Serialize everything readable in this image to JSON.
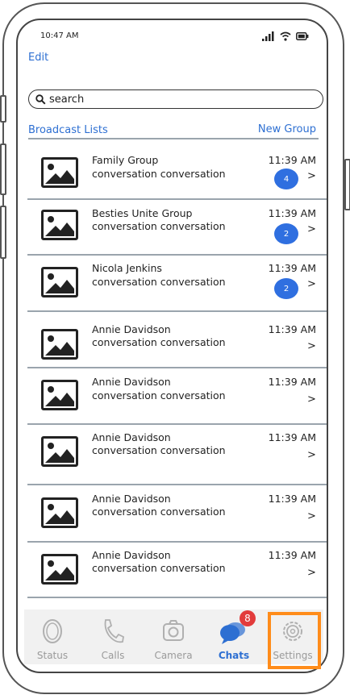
{
  "status_bar": {
    "time": "10:47 AM",
    "icons": [
      "signal-icon",
      "wifi-icon",
      "battery-icon"
    ]
  },
  "header": {
    "edit_label": "Edit"
  },
  "search": {
    "value": "search"
  },
  "lists": {
    "broadcast_label": "Broadcast Lists",
    "new_group_label": "New Group"
  },
  "chats": [
    {
      "name": "Family Group",
      "preview": "conversation conversation",
      "time": "11:39 AM",
      "badge": "4"
    },
    {
      "name": "Besties Unite Group",
      "preview": "conversation conversation",
      "time": "11:39 AM",
      "badge": "2"
    },
    {
      "name": "Nicola Jenkins",
      "preview": "conversation conversation",
      "time": "11:39 AM",
      "badge": "2"
    },
    {
      "name": "Annie Davidson",
      "preview": "conversation conversation",
      "time": "11:39 AM",
      "badge": ""
    },
    {
      "name": "Annie Davidson",
      "preview": "conversation conversation",
      "time": "11:39 AM",
      "badge": ""
    },
    {
      "name": "Annie Davidson",
      "preview": "conversation conversation",
      "time": "11:39 AM",
      "badge": ""
    },
    {
      "name": "Annie Davidson",
      "preview": "conversation conversation",
      "time": "11:39 AM",
      "badge": ""
    },
    {
      "name": "Annie Davidson",
      "preview": "conversation conversation",
      "time": "11:39 AM",
      "badge": ""
    }
  ],
  "chevron": ">",
  "tabbar": {
    "tabs": [
      {
        "label": "Status",
        "icon": "status-icon",
        "active": false
      },
      {
        "label": "Calls",
        "icon": "phone-icon",
        "active": false
      },
      {
        "label": "Camera",
        "icon": "camera-icon",
        "active": false
      },
      {
        "label": "Chats",
        "icon": "chat-bubbles-icon",
        "active": true,
        "badge": "8"
      },
      {
        "label": "Settings",
        "icon": "gear-icon",
        "active": false
      }
    ]
  },
  "colors": {
    "accent": "#2d6fd2",
    "badge_blue": "#2f6fe0",
    "badge_red": "#e23b3b",
    "highlight": "#ff8c1a"
  }
}
